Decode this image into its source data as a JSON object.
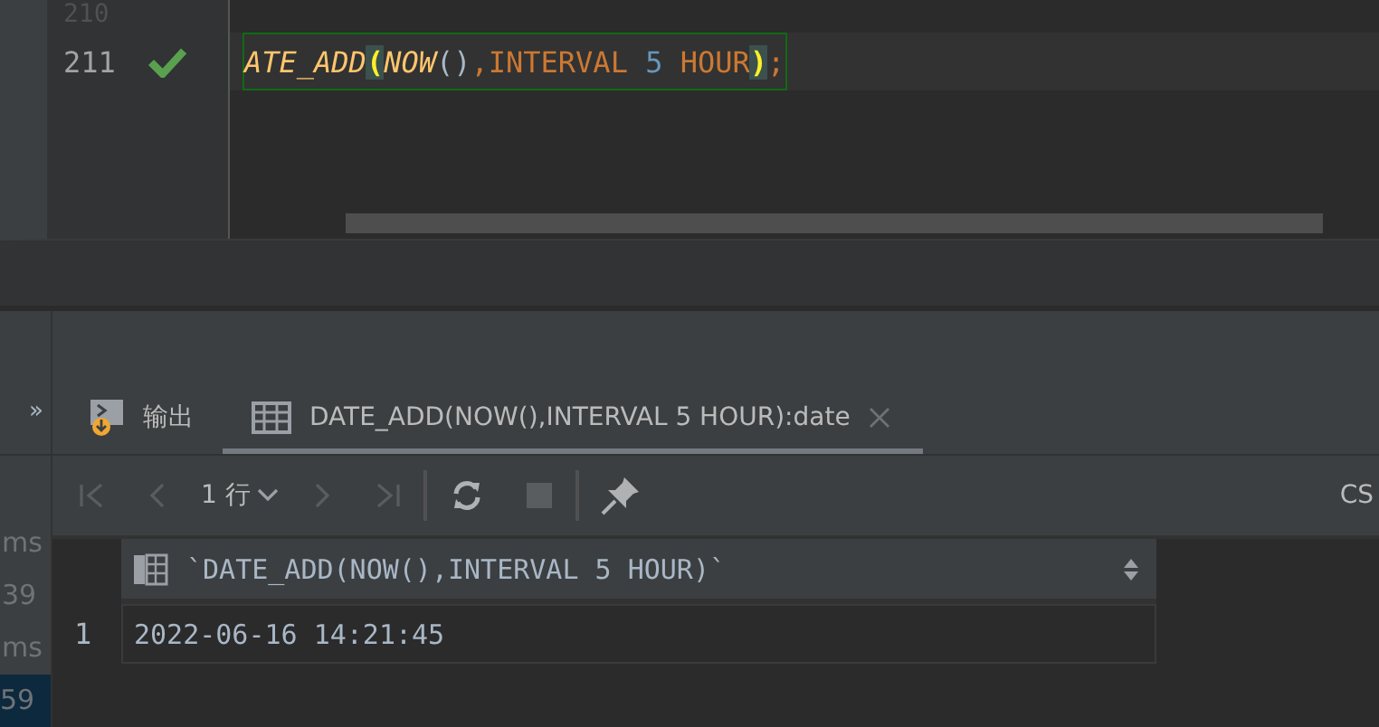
{
  "editor": {
    "lines": [
      {
        "number": "210",
        "check": false
      },
      {
        "number": "211",
        "check": true,
        "tokens": [
          {
            "kind": "function",
            "text": "ATE_ADD"
          },
          {
            "kind": "match",
            "text": "("
          },
          {
            "kind": "function",
            "text": "NOW"
          },
          {
            "kind": "paren",
            "text": "()"
          },
          {
            "kind": "keyword",
            "text": ",INTERVAL "
          },
          {
            "kind": "number",
            "text": "5"
          },
          {
            "kind": "keyword",
            "text": " HOUR"
          },
          {
            "kind": "match",
            "text": ")"
          },
          {
            "kind": "keyword",
            "text": ";"
          }
        ]
      }
    ]
  },
  "side_list": [
    {
      "text": "ms",
      "selected": false
    },
    {
      "text": "39",
      "selected": false
    },
    {
      "text": "ms",
      "selected": false
    },
    {
      "text": "59",
      "selected": true
    }
  ],
  "side_toggle": "»",
  "tabs": [
    {
      "label": "输出",
      "kind": "output",
      "selected": false,
      "closable": false
    },
    {
      "label": "DATE_ADD(NOW(),INTERVAL 5 HOUR):date",
      "kind": "table",
      "selected": true,
      "closable": true
    }
  ],
  "toolbar": {
    "rows": "1 行",
    "right_label": "CS"
  },
  "grid": {
    "columns": [
      "`DATE_ADD(NOW(),INTERVAL 5 HOUR)`"
    ],
    "rows": [
      {
        "number": "1",
        "cells": [
          "2022-06-16 14:21:45"
        ]
      }
    ]
  }
}
